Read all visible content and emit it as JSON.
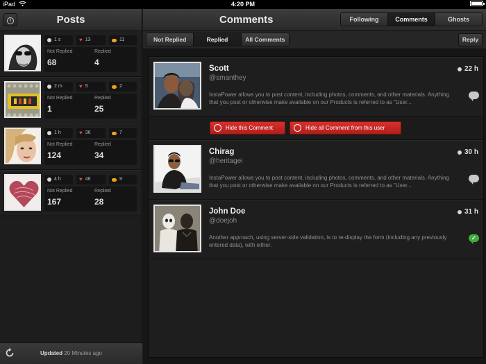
{
  "statusbar": {
    "device": "iPad",
    "time": "4:20 PM"
  },
  "left": {
    "title": "Posts",
    "info_label": "i",
    "posts": [
      {
        "time": "1 s",
        "likes": "13",
        "comments": "11",
        "not_replied_label": "Not Replied",
        "replied_label": "Replied",
        "not_replied": "68",
        "replied": "4"
      },
      {
        "time": "2 m",
        "likes": "5",
        "comments": "2",
        "not_replied_label": "Not Replied",
        "replied_label": "Replied",
        "not_replied": "1",
        "replied": "25"
      },
      {
        "time": "1 h",
        "likes": "36",
        "comments": "7",
        "not_replied_label": "Not Replied",
        "replied_label": "Replied",
        "not_replied": "124",
        "replied": "34"
      },
      {
        "time": "4 h",
        "likes": "46",
        "comments": "9",
        "not_replied_label": "Not Replied",
        "replied_label": "Replied",
        "not_replied": "167",
        "replied": "28"
      }
    ],
    "footer": {
      "updated_label": "Updated",
      "updated_when": "20 Minutes ago"
    }
  },
  "right": {
    "title": "Comments",
    "top_tabs": [
      "Following",
      "Comments",
      "Ghosts"
    ],
    "top_tab_active": "Comments",
    "filters": [
      "Not Replied",
      "Replied",
      "All Comments"
    ],
    "filter_active": "Replied",
    "reply_label": "Reply",
    "comments": [
      {
        "name": "Scott",
        "handle": "@smanthey",
        "time": "22 h",
        "text": "InstaPower allows you to post content, including photos, comments, and other materials. Anything that you post or otherwise make available on our Products is referred to as \"User..."
      },
      {
        "name": "Chirag",
        "handle": "@heritagei",
        "time": "30 h",
        "text": "InstaPower allows you to post content, including photos, comments, and other materials. Anything that you post or otherwise make available on our Products is referred to as \"User..."
      },
      {
        "name": "John Doe",
        "handle": "@doejoh",
        "time": "31 h",
        "text": "Another approach, using server-side validation, is to re-display the form (including any previously entered data), with either."
      }
    ],
    "actions": {
      "hide_comment": "Hide this Comment",
      "hide_all": "Hide all Comment from this user"
    }
  },
  "colors": {
    "accent_red": "#c4241f",
    "status_green": "#3fae3c",
    "warning_orange": "#f0a21a",
    "heart_red": "#e0463f"
  }
}
